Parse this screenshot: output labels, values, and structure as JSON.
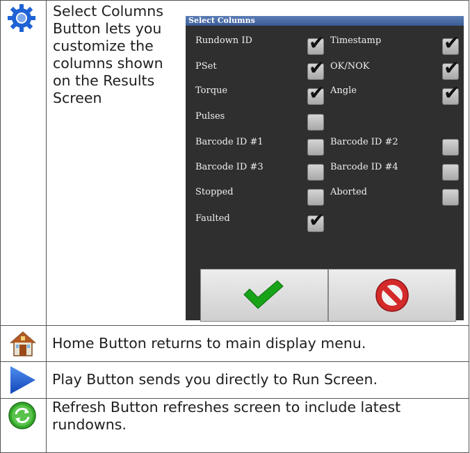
{
  "rows": [
    {
      "icon": "gear-icon",
      "text": "Select Columns Button lets you customize the columns shown on the Results Screen"
    },
    {
      "icon": "home-icon",
      "text": "Home Button returns to main display menu."
    },
    {
      "icon": "play-icon",
      "text": "Play Button sends you directly to Run Screen."
    },
    {
      "icon": "refresh-icon",
      "text": "Refresh Button refreshes screen to include latest rundowns."
    }
  ],
  "dialog": {
    "title": "Select Columns",
    "options": [
      {
        "label": "Rundown ID",
        "checked": true
      },
      {
        "label": "Timestamp",
        "checked": true
      },
      {
        "label": "PSet",
        "checked": true
      },
      {
        "label": "OK/NOK",
        "checked": true
      },
      {
        "label": "Torque",
        "checked": true
      },
      {
        "label": "Angle",
        "checked": true
      },
      {
        "label": "Pulses",
        "checked": false
      },
      {
        "label": "Barcode ID #1",
        "checked": false
      },
      {
        "label": "Barcode ID #2",
        "checked": false
      },
      {
        "label": "Barcode ID #3",
        "checked": false
      },
      {
        "label": "Barcode ID #4",
        "checked": false
      },
      {
        "label": "Stopped",
        "checked": false
      },
      {
        "label": "Aborted",
        "checked": false
      },
      {
        "label": "Faulted",
        "checked": true
      }
    ],
    "check_glyph": "✔",
    "buttons": {
      "ok_icon": "checkmark-icon",
      "cancel_icon": "cancel-icon"
    }
  },
  "colors": {
    "accent_blue": "#1f5fd0",
    "ok_green": "#19a319",
    "cancel_red": "#d42a2a"
  }
}
